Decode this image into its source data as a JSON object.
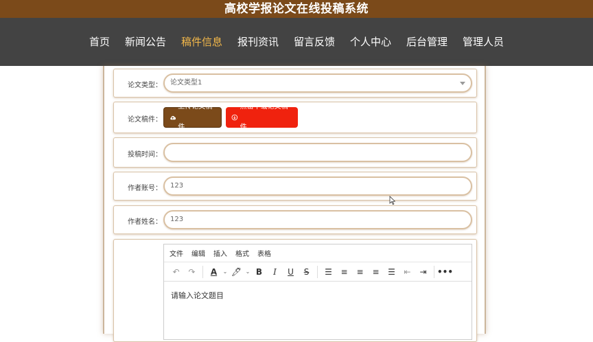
{
  "app": {
    "title": "高校学报论文在线投稿系统"
  },
  "nav": {
    "items": [
      {
        "label": "首页"
      },
      {
        "label": "新闻公告"
      },
      {
        "label": "稿件信息"
      },
      {
        "label": "报刊资讯"
      },
      {
        "label": "留言反馈"
      },
      {
        "label": "个人中心"
      },
      {
        "label": "后台管理"
      },
      {
        "label": "管理人员"
      }
    ],
    "active": "稿件信息"
  },
  "form": {
    "type": {
      "label": "论文类型：",
      "value": "论文类型1"
    },
    "file": {
      "label": "论文稿件：",
      "upload_label": "上传论文稿件",
      "download_label": "点击下载论文稿件"
    },
    "time": {
      "label": "投稿时间：",
      "value": ""
    },
    "account": {
      "label": "作者账号：",
      "value": "123"
    },
    "name": {
      "label": "作者姓名：",
      "value": "123"
    },
    "editor": {
      "menu": [
        "文件",
        "编辑",
        "插入",
        "格式",
        "表格"
      ],
      "content": "请输入论文题目"
    }
  },
  "colors": {
    "header": "#7b4a1a",
    "nav": "#434343",
    "active": "#f3b84a",
    "download": "#f0220e"
  }
}
